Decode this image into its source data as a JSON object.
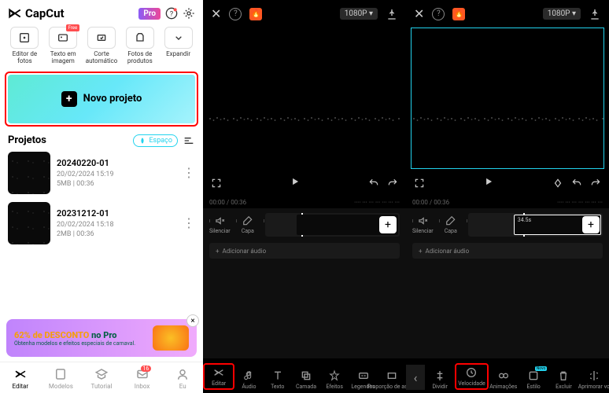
{
  "app": {
    "name": "CapCut",
    "pro": "Pro"
  },
  "tools": [
    {
      "label": "Editor de fotos"
    },
    {
      "label": "Texto em imagem",
      "free": "Free"
    },
    {
      "label": "Corte automático"
    },
    {
      "label": "Fotos de produtos"
    },
    {
      "label": "Expandir"
    }
  ],
  "newProject": "Novo projeto",
  "projectsTitle": "Projetos",
  "space": "Espaço",
  "projects": [
    {
      "name": "20240220-01",
      "date": "20/02/2024 15:19",
      "meta": "5MB | 00:36"
    },
    {
      "name": "20231212-01",
      "date": "20/02/2024 15:18",
      "meta": "2MB | 00:36"
    }
  ],
  "promo": {
    "main1": "62% de ",
    "main2": "DESCONTO",
    "main3": " no Pro",
    "sub": "Obtenha modelos e efeitos especiais de carnaval."
  },
  "bottomNav": [
    {
      "label": "Editar"
    },
    {
      "label": "Modelos"
    },
    {
      "label": "Tutorial"
    },
    {
      "label": "Inbox",
      "badge": "16"
    },
    {
      "label": "Eu"
    }
  ],
  "editor": {
    "res": "1080P",
    "time": {
      "cur": "00:00",
      "total": "00:36"
    },
    "silence": "Silenciar",
    "cover": "Capa",
    "addAudio": "Adicionar áudio",
    "clipTime": "34.5s"
  },
  "darkNav1": [
    {
      "label": "Editar",
      "hl": true
    },
    {
      "label": "Áudio"
    },
    {
      "label": "Texto"
    },
    {
      "label": "Camada"
    },
    {
      "label": "Efeitos"
    },
    {
      "label": "Legendas"
    },
    {
      "label": "Proporção de aspec"
    }
  ],
  "darkNav2": [
    {
      "label": "Dividir"
    },
    {
      "label": "Velocidade",
      "hl": true
    },
    {
      "label": "Animações"
    },
    {
      "label": "Estilo",
      "new": "Novo"
    },
    {
      "label": "Excluir"
    },
    {
      "label": "Aprimorar vo"
    }
  ]
}
